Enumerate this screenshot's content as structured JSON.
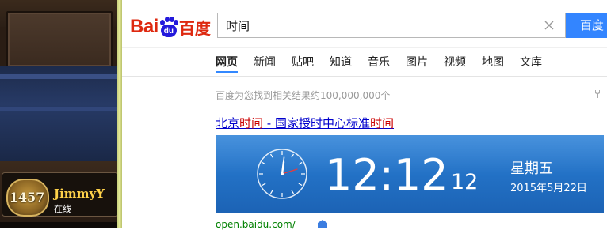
{
  "game": {
    "rank": "1457",
    "player_name": "JimmyY",
    "status": "在线"
  },
  "baidu": {
    "logo_latin": "Bai",
    "logo_paw_text": "du",
    "logo_cn": "百度",
    "query": "时间",
    "search_button": "百度",
    "tabs": [
      {
        "label": "网页",
        "active": true
      },
      {
        "label": "新闻"
      },
      {
        "label": "贴吧"
      },
      {
        "label": "知道"
      },
      {
        "label": "音乐"
      },
      {
        "label": "图片"
      },
      {
        "label": "视频"
      },
      {
        "label": "地图"
      },
      {
        "label": "文库"
      }
    ],
    "results_count": "百度为您找到相关结果约100,000,000个",
    "result": {
      "title_part1": "北京",
      "title_hl1": "时间",
      "title_part2": " - 国家授时中心标准",
      "title_hl2": "时间",
      "url": "open.baidu.com/"
    },
    "time_card": {
      "time": "12:12",
      "seconds": "12",
      "weekday": "星期五",
      "date": "2015年5月22日"
    }
  },
  "colors": {
    "baidu_red": "#de2910",
    "baidu_blue": "#2319dc",
    "search_button": "#3385ff",
    "link": "#0000cc",
    "highlight": "#cc0000",
    "url": "#008000",
    "time_card": "#2f83d8"
  }
}
